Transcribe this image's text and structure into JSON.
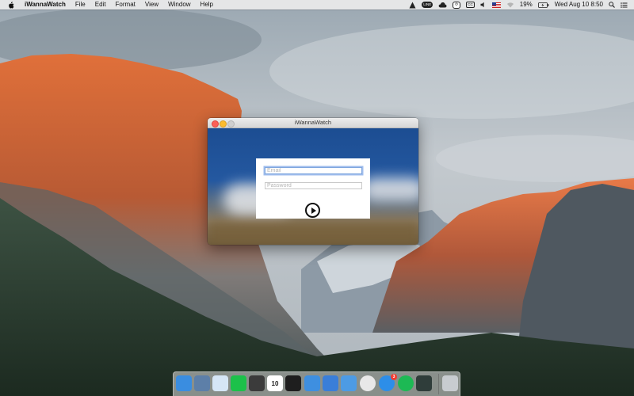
{
  "menubar": {
    "apple_icon": "apple-icon",
    "app_name": "iWannaWatch",
    "menus": [
      "File",
      "Edit",
      "Format",
      "View",
      "Window",
      "Help"
    ],
    "status": {
      "line_label": "LINE",
      "battery_percent": "19%",
      "datetime": "Wed Aug 10  8:50"
    }
  },
  "window": {
    "title": "iWannaWatch",
    "email_placeholder": "Email",
    "password_placeholder": "Password",
    "accent_color": "#1c4d92"
  },
  "dock": {
    "items": [
      {
        "name": "finder",
        "color": "#3a8de0",
        "dot": false
      },
      {
        "name": "preview",
        "color": "#5d7fa8",
        "dot": false
      },
      {
        "name": "messages",
        "color": "#d5e6f6",
        "dot": false
      },
      {
        "name": "line",
        "color": "#1cc14a",
        "dot": false
      },
      {
        "name": "sublime-text",
        "color": "#3b3b3b",
        "dot": false
      },
      {
        "name": "calendar",
        "color": "#ffffff",
        "dot": false,
        "label": "10"
      },
      {
        "name": "terminal",
        "color": "#1e1e1e",
        "dot": false
      },
      {
        "name": "upload",
        "color": "#3e8fe0",
        "dot": false
      },
      {
        "name": "xcode",
        "color": "#3a7ed8",
        "dot": false
      },
      {
        "name": "folder",
        "color": "#4d9be4",
        "dot": false
      },
      {
        "name": "chrome",
        "color": "#e8e8e8",
        "dot": false
      },
      {
        "name": "app-store",
        "color": "#2d8ee8",
        "dot": false,
        "badge": "3"
      },
      {
        "name": "spotify",
        "color": "#1db954",
        "dot": false
      },
      {
        "name": "claquette",
        "color": "#2f3d3a",
        "dot": false
      },
      {
        "name": "trash",
        "color": "#c8ccd0",
        "dot": false
      }
    ]
  }
}
